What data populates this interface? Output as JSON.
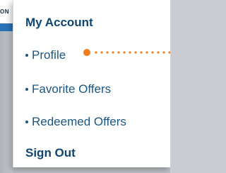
{
  "background": {
    "header_text": "ON"
  },
  "menu": {
    "items": [
      {
        "label": "My Account",
        "bullet": ""
      },
      {
        "label": "Profile",
        "bullet": "•"
      },
      {
        "label": "Favorite Offers",
        "bullet": "•"
      },
      {
        "label": "Redeemed Offers",
        "bullet": "•"
      },
      {
        "label": "Sign Out",
        "bullet": ""
      }
    ]
  },
  "colors": {
    "menu_text": "#11456f",
    "callout": "#ef7d22",
    "menu_background": "#ffffff"
  }
}
